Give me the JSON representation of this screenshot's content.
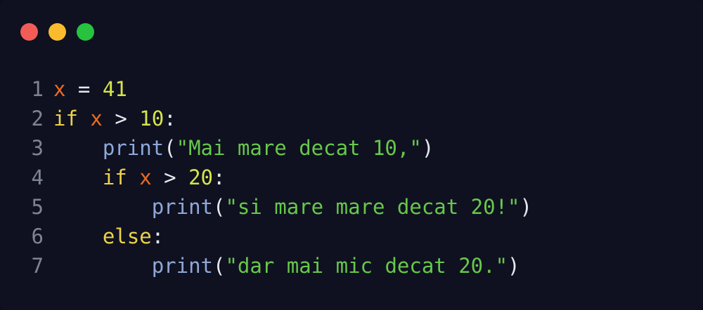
{
  "window": {
    "controls": [
      {
        "name": "close",
        "color": "#f25c56"
      },
      {
        "name": "minimize",
        "color": "#f9bb2d"
      },
      {
        "name": "maximize",
        "color": "#27c33f"
      }
    ]
  },
  "colors": {
    "background": "#0f1120",
    "line_number": "#7e8494",
    "keyword": "#ecd24a",
    "variable": "#ee6a1f",
    "number": "#d5e54a",
    "string": "#67c84b",
    "function": "#8fa8d9",
    "default": "#e6e8ef"
  },
  "code": {
    "lines": [
      {
        "number": "1",
        "tokens": [
          {
            "t": "x",
            "k": "var"
          },
          {
            "t": " = ",
            "k": "op"
          },
          {
            "t": "41",
            "k": "num"
          }
        ]
      },
      {
        "number": "2",
        "tokens": [
          {
            "t": "if",
            "k": "kw"
          },
          {
            "t": " ",
            "k": "op"
          },
          {
            "t": "x",
            "k": "var"
          },
          {
            "t": " > ",
            "k": "op"
          },
          {
            "t": "10",
            "k": "num"
          },
          {
            "t": ":",
            "k": "op"
          }
        ]
      },
      {
        "number": "3",
        "tokens": [
          {
            "t": "    ",
            "k": "op"
          },
          {
            "t": "print",
            "k": "fn"
          },
          {
            "t": "(",
            "k": "op"
          },
          {
            "t": "\"Mai mare decat 10,\"",
            "k": "str"
          },
          {
            "t": ")",
            "k": "op"
          }
        ]
      },
      {
        "number": "4",
        "tokens": [
          {
            "t": "    ",
            "k": "op"
          },
          {
            "t": "if",
            "k": "kw"
          },
          {
            "t": " ",
            "k": "op"
          },
          {
            "t": "x",
            "k": "var"
          },
          {
            "t": " > ",
            "k": "op"
          },
          {
            "t": "20",
            "k": "num"
          },
          {
            "t": ":",
            "k": "op"
          }
        ]
      },
      {
        "number": "5",
        "tokens": [
          {
            "t": "        ",
            "k": "op"
          },
          {
            "t": "print",
            "k": "fn"
          },
          {
            "t": "(",
            "k": "op"
          },
          {
            "t": "\"si mare mare decat 20!\"",
            "k": "str"
          },
          {
            "t": ")",
            "k": "op"
          }
        ]
      },
      {
        "number": "6",
        "tokens": [
          {
            "t": "    ",
            "k": "op"
          },
          {
            "t": "else",
            "k": "kw"
          },
          {
            "t": ":",
            "k": "op"
          }
        ]
      },
      {
        "number": "7",
        "tokens": [
          {
            "t": "        ",
            "k": "op"
          },
          {
            "t": "print",
            "k": "fn"
          },
          {
            "t": "(",
            "k": "op"
          },
          {
            "t": "\"dar mai mic decat 20.\"",
            "k": "str"
          },
          {
            "t": ")",
            "k": "op"
          }
        ]
      }
    ]
  }
}
